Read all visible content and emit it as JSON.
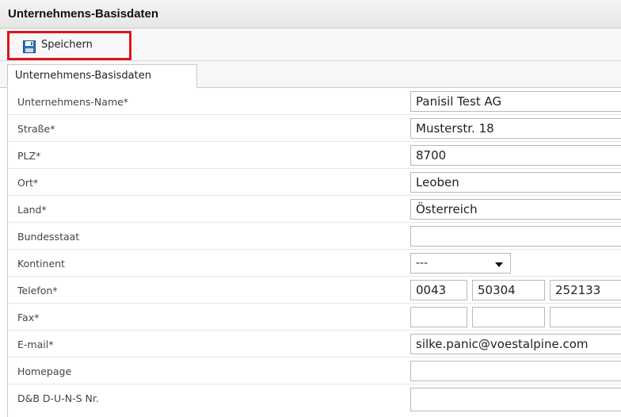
{
  "window": {
    "title": "Unternehmens-Basisdaten"
  },
  "toolbar": {
    "save_label": "Speichern",
    "save_icon": "floppy-disk-icon"
  },
  "tabs": [
    {
      "label": "Unternehmens-Basisdaten",
      "active": true
    }
  ],
  "form": {
    "company_name": {
      "label": "Unternehmens-Name*",
      "value": "Panisil Test AG"
    },
    "street": {
      "label": "Straße*",
      "value": "Musterstr. 18"
    },
    "zip": {
      "label": "PLZ*",
      "value": "8700"
    },
    "city": {
      "label": "Ort*",
      "value": "Leoben"
    },
    "country": {
      "label": "Land*",
      "value": "Österreich"
    },
    "state": {
      "label": "Bundesstaat",
      "value": ""
    },
    "continent": {
      "label": "Kontinent",
      "value": "---"
    },
    "phone": {
      "label": "Telefon*",
      "country_code": "0043",
      "area_code": "50304",
      "number": "252133"
    },
    "fax": {
      "label": "Fax*",
      "country_code": "",
      "area_code": "",
      "number": ""
    },
    "email": {
      "label": "E-mail*",
      "value": "silke.panic@voestalpine.com"
    },
    "homepage": {
      "label": "Homepage",
      "value": ""
    },
    "duns": {
      "label": "D&B D-U-N-S Nr.",
      "value": ""
    }
  },
  "colors": {
    "highlight_border": "#e0141c",
    "header_bg": "#ececec"
  }
}
